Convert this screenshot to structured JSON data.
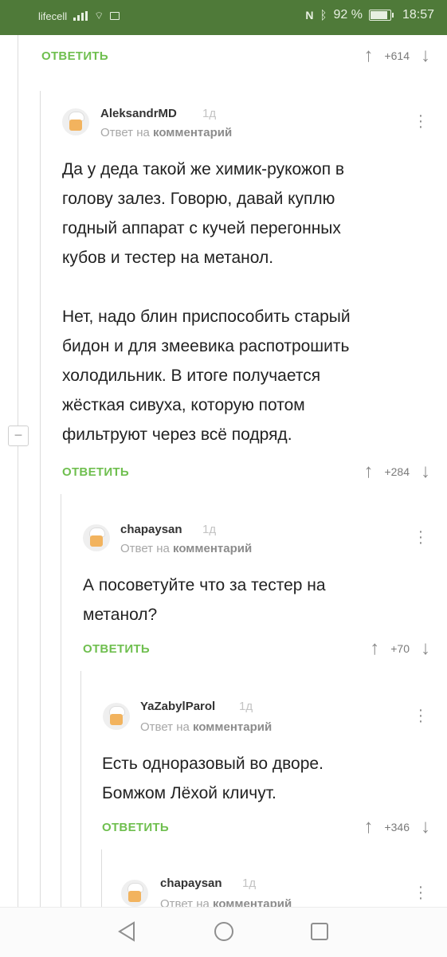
{
  "status_bar": {
    "carrier": "lifecell",
    "battery": "92 %",
    "time": "18:57",
    "icons": [
      "signal-icon",
      "wifi-icon",
      "nfc-icon",
      "bluetooth-icon",
      "battery-icon"
    ]
  },
  "top_actions": {
    "reply_label": "ОТВЕТИТЬ",
    "score": "+614"
  },
  "comments": [
    {
      "username": "AleksandrMD",
      "time": "1д",
      "reply_prefix": "Ответ на",
      "reply_target": "комментарий",
      "paragraph1": [
        "Да у деда такой же химик-рукожоп в",
        "голову залез. Говорю, давай куплю",
        "годный аппарат с кучей перегонных",
        "кубов и тестер на метанол."
      ],
      "paragraph2": [
        "Нет, надо блин приспособить старый",
        "бидон и для змеевика распотрошить",
        "холодильник. В итоге получается",
        "жёсткая сивуха, которую потом",
        "фильтруют через всё подряд."
      ],
      "reply_label": "ОТВЕТИТЬ",
      "score": "+284"
    },
    {
      "username": "chapaysan",
      "time": "1д",
      "reply_prefix": "Ответ на",
      "reply_target": "комментарий",
      "lines": [
        "А посоветуйте что за тестер на",
        "метанол?"
      ],
      "reply_label": "ОТВЕТИТЬ",
      "score": "+70"
    },
    {
      "username": "YaZabylParol",
      "time": "1д",
      "reply_prefix": "Ответ на",
      "reply_target": "комментарий",
      "lines": [
        "Есть одноразовый во дворе.",
        "Бомжом Лёхой кличут."
      ],
      "reply_label": "ОТВЕТИТЬ",
      "score": "+346"
    },
    {
      "username": "chapaysan",
      "time": "1д",
      "reply_prefix": "Ответ на",
      "reply_target": "комментарий"
    }
  ],
  "colors": {
    "status_bar": "#4f7a39",
    "reply_green": "#6fbf4f",
    "thread_line": "#dcdcdc"
  }
}
